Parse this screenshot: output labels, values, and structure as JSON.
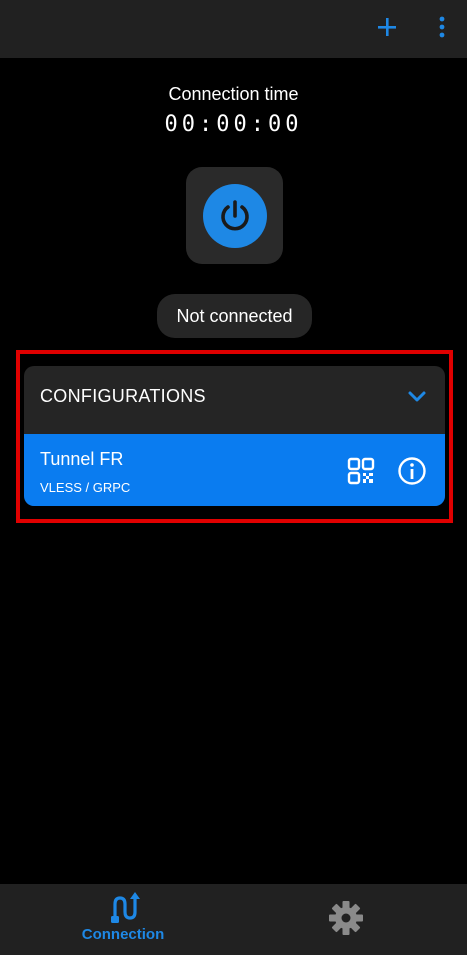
{
  "topbar": {
    "add_icon": "plus-icon",
    "more_icon": "more-vert-icon"
  },
  "connection": {
    "time_label": "Connection time",
    "time_value": "00:00:00",
    "power_icon": "power-icon",
    "status": "Not connected"
  },
  "configurations": {
    "header": "CONFIGURATIONS",
    "expand_icon": "chevron-down-icon",
    "items": [
      {
        "name": "Tunnel FR",
        "protocol": "VLESS / GRPC",
        "qr_icon": "qr-code-icon",
        "info_icon": "info-icon"
      }
    ]
  },
  "bottom_nav": {
    "connection_label": "Connection",
    "connection_icon": "connection-route-icon",
    "settings_icon": "gear-icon"
  },
  "colors": {
    "accent": "#1e88e5",
    "selected_item": "#0a7cf0",
    "highlight_border": "#e00000",
    "background": "#000000",
    "surface": "#252525"
  }
}
